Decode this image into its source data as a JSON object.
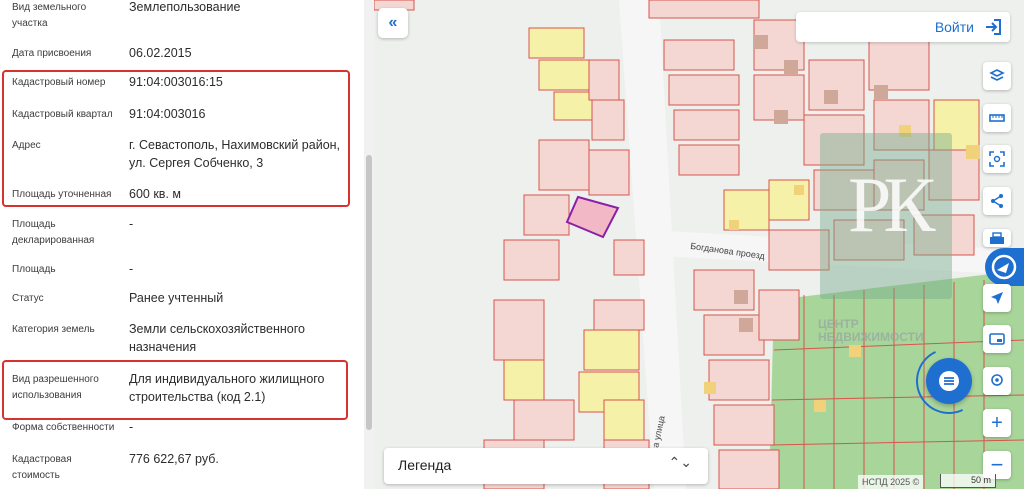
{
  "fields": [
    {
      "label": "Вид земельного участка",
      "value": "Землепользование"
    },
    {
      "label": "Дата присвоения",
      "value": "06.02.2015"
    },
    {
      "label": "Кадастровый номер",
      "value": "91:04:003016:15"
    },
    {
      "label": "Кадастровый квартал",
      "value": "91:04:003016"
    },
    {
      "label": "Адрес",
      "value": "г. Севастополь, Нахимовский район, ул. Сергея Собченко, 3"
    },
    {
      "label": "Площадь уточненная",
      "value": "600 кв. м"
    },
    {
      "label": "Площадь декларированная",
      "value": "-"
    },
    {
      "label": "Площадь",
      "value": "-"
    },
    {
      "label": "Статус",
      "value": "Ранее учтенный"
    },
    {
      "label": "Категория земель",
      "value": "Земли сельскохозяйственного назначения"
    },
    {
      "label": "Вид разрешенного использования",
      "value": "Для индивидуального жилищного строительства (код 2.1)"
    },
    {
      "label": "Форма собственности",
      "value": "-"
    },
    {
      "label": "Кадастровая стоимость",
      "value": "776 622,67 руб."
    }
  ],
  "map": {
    "login_label": "Войти",
    "legend_label": "Легенда",
    "attribution": "НСПД 2025 ©",
    "scale_label": "50 m",
    "street_1": "Богданова проезд",
    "street_2": "...ова улица",
    "watermark_letters": "РК",
    "watermark_text_1": "ЦЕНТР",
    "watermark_text_2": "НЕДВИЖИМОСТИ"
  },
  "colors": {
    "accent": "#1f6fd0",
    "highlight": "#d8322e",
    "parcel_border": "#d9544c",
    "selected_parcel": "#8a1fa8"
  },
  "icons": [
    "collapse-left-icon",
    "login-icon",
    "layers-icon",
    "ruler-icon",
    "area-select-icon",
    "share-icon",
    "print-icon",
    "locate-icon",
    "screen-icon",
    "pin-search-icon",
    "zoom-in-icon",
    "zoom-out-icon",
    "chat-icon"
  ]
}
